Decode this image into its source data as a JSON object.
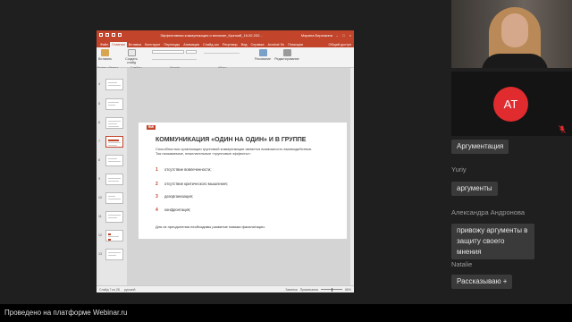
{
  "ppt": {
    "doc_title": "Эффективная коммуникация и влияние_Краткий_16.02.202...",
    "user_name": "Марина Березкина",
    "window_controls": [
      "–",
      "□",
      "×"
    ],
    "tabs": [
      "Файл",
      "Главная",
      "Вставка",
      "Конструкт",
      "Переходы",
      "Анимация",
      "Слайд-шо",
      "Рецензир",
      "Вид",
      "Справка",
      "Acrobat Su",
      "Помощни"
    ],
    "tabs_right": "Общий доступ",
    "ribbon": {
      "paste_label": "Вставить",
      "new_slide_label": "Создать слайд",
      "drawing_label": "Рисование",
      "editing_label": "Редактирование",
      "group_clipboard": "Буфер обмена",
      "group_slides": "Слайды",
      "group_font": "Шрифт",
      "group_paragraph": "Абзац"
    },
    "thumb_numbers": [
      "4",
      "5",
      "6",
      "7",
      "8",
      "9",
      "10",
      "11",
      "12",
      "13"
    ],
    "status_left": "Слайд 7 из 28",
    "status_lang": "русский",
    "status_notes": "Заметки",
    "status_comments": "Примечания",
    "status_zoom": "65%"
  },
  "slide": {
    "logo": "RMI",
    "title": "КОММУНИКАЦИЯ «ОДИН НА ОДИН» И В ГРУППЕ",
    "intro": "Способностью организации групповой коммуникации является возможность взаимодействия. Так называемые, нежелательные «групповые эффекты»:",
    "items": [
      {
        "num": "1",
        "text": "отсутствие вовлеченности;"
      },
      {
        "num": "2",
        "text": "отсутствие критического мышления;"
      },
      {
        "num": "3",
        "text": "дезорганизация;"
      },
      {
        "num": "4",
        "text": "конфронтация;"
      }
    ],
    "conclusion": "Для их преодоления необходимы развитые навыки фасилитации."
  },
  "participants": {
    "avatar_initials": "AT"
  },
  "chat": [
    {
      "name": "",
      "message": "Аргументация"
    },
    {
      "name": "Yuriy",
      "message": "аргументы"
    },
    {
      "name": "Александра Андронова",
      "message": "привожу аргументы в защиту своего мнения"
    },
    {
      "name": "Natalie",
      "message": "Рассказываю +"
    }
  ],
  "footer": {
    "text": "Проведено на платформе Webinar.ru"
  },
  "colors": {
    "accent": "#c2442b",
    "avatar": "#e02b2f",
    "background": "#1f1f1f"
  }
}
